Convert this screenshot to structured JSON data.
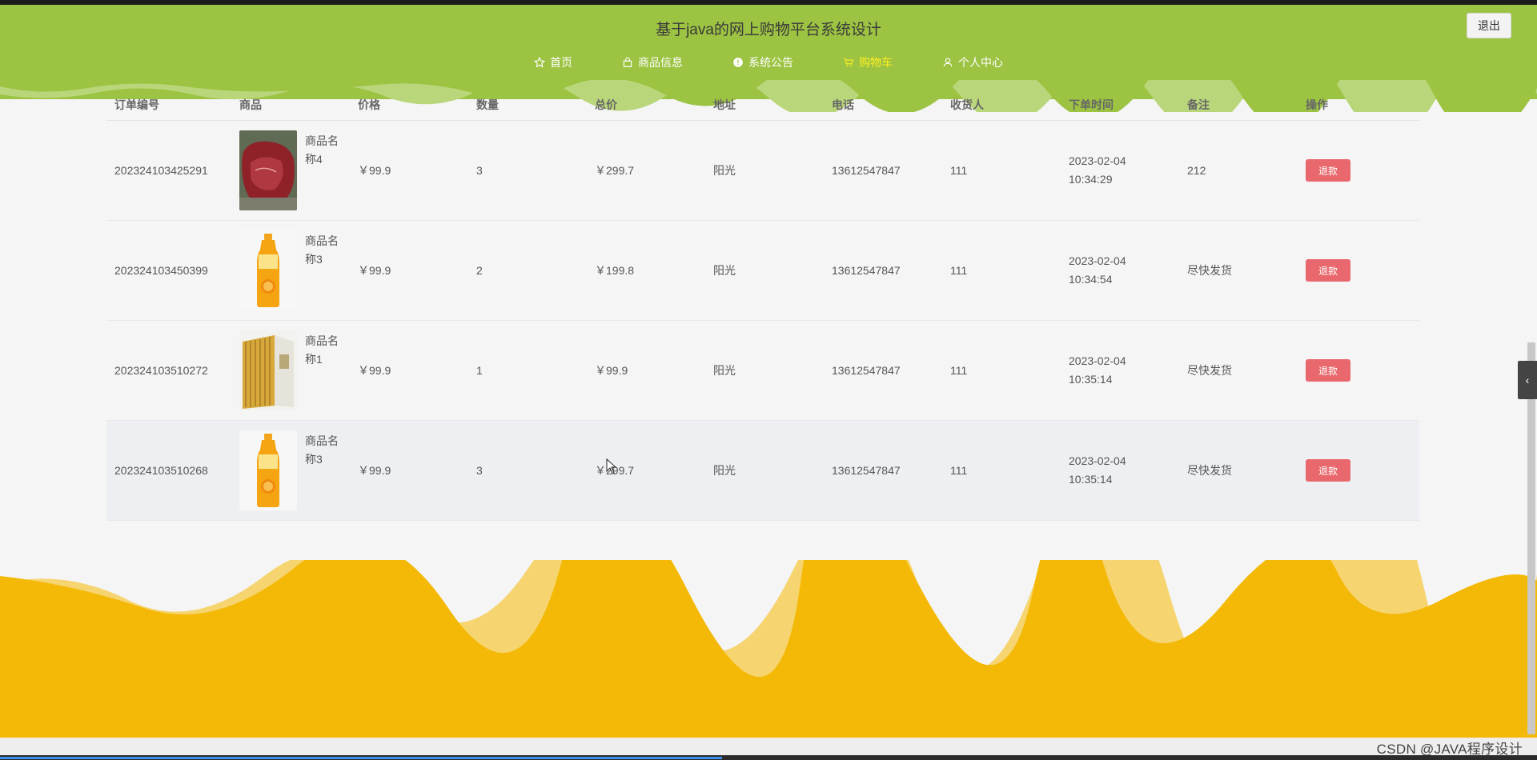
{
  "header": {
    "site_title": "基于java的网上购物平台系统设计",
    "logout_label": "退出",
    "bg_color": "#9cc342",
    "active_color": "#ffee22"
  },
  "nav": {
    "items": [
      {
        "label": "首页",
        "icon": "star-icon"
      },
      {
        "label": "商品信息",
        "icon": "bag-icon"
      },
      {
        "label": "系统公告",
        "icon": "info-circle-icon"
      },
      {
        "label": "购物车",
        "icon": "cart-icon",
        "active": true
      },
      {
        "label": "个人中心",
        "icon": "user-icon"
      }
    ]
  },
  "orders_table": {
    "columns": [
      "订单编号",
      "商品",
      "价格",
      "数量",
      "总价",
      "地址",
      "电话",
      "收货人",
      "下单时间",
      "备注",
      "操作"
    ],
    "rows": [
      {
        "order_no": "202324103425291",
        "product_name": "商品名称4",
        "product_image": "beef-image",
        "price": "￥99.9",
        "qty": "3",
        "total": "￥299.7",
        "address": "阳光",
        "phone": "13612547847",
        "receiver": "111",
        "time": "2023-02-04 10:34:29",
        "note": "212",
        "action": "退款"
      },
      {
        "order_no": "202324103450399",
        "product_name": "商品名称3",
        "product_image": "orange-juice-image",
        "price": "￥99.9",
        "qty": "2",
        "total": "￥199.8",
        "address": "阳光",
        "phone": "13612547847",
        "receiver": "111",
        "time": "2023-02-04 10:34:54",
        "note": "尽快发货",
        "action": "退款"
      },
      {
        "order_no": "202324103510272",
        "product_name": "商品名称1",
        "product_image": "book-set-image",
        "price": "￥99.9",
        "qty": "1",
        "total": "￥99.9",
        "address": "阳光",
        "phone": "13612547847",
        "receiver": "111",
        "time": "2023-02-04 10:35:14",
        "note": "尽快发货",
        "action": "退款"
      },
      {
        "order_no": "202324103510268",
        "product_name": "商品名称3",
        "product_image": "orange-juice-image",
        "price": "￥99.9",
        "qty": "3",
        "total": "￥299.7",
        "address": "阳光",
        "phone": "13612547847",
        "receiver": "111",
        "time": "2023-02-04 10:35:14",
        "note": "尽快发货",
        "action": "退款"
      }
    ]
  },
  "footer": {
    "wave_color": "#f4b907",
    "wave_light_color": "#f6d46f"
  },
  "watermark": "CSDN @JAVA程序设计",
  "scroll_progress": 0.47
}
